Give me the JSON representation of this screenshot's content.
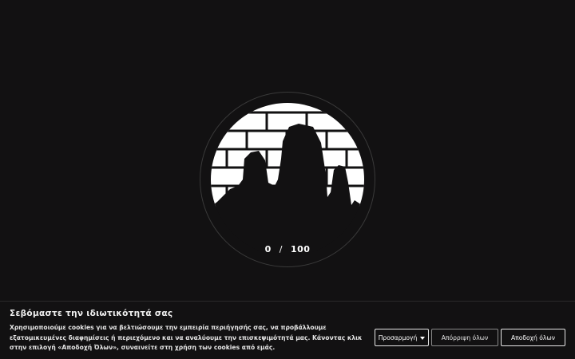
{
  "loader": {
    "progress_current": "0",
    "progress_separator": "/",
    "progress_total": "100",
    "progress_fraction": 0
  },
  "cookie_banner": {
    "title": "Σεβόμαστε την ιδιωτικότητά σας",
    "text": "Χρησιμοποιούμε cookies για να βελτιώσουμε την εμπειρία περιήγησής σας, να προβάλλουμε εξατομικευμένες διαφημίσεις ή περιεχόμενο και να αναλύουμε την επισκεψιμότητά μας. Κάνοντας κλικ στην επιλογή «Αποδοχή Όλων», συναινείτε στη χρήση των cookies από εμάς.",
    "customize_label": "Προσαρμογή",
    "reject_label": "Απόρριψη όλων",
    "accept_label": "Αποδοχή όλων"
  },
  "colors": {
    "background": "#121112",
    "text": "#ffffff"
  }
}
